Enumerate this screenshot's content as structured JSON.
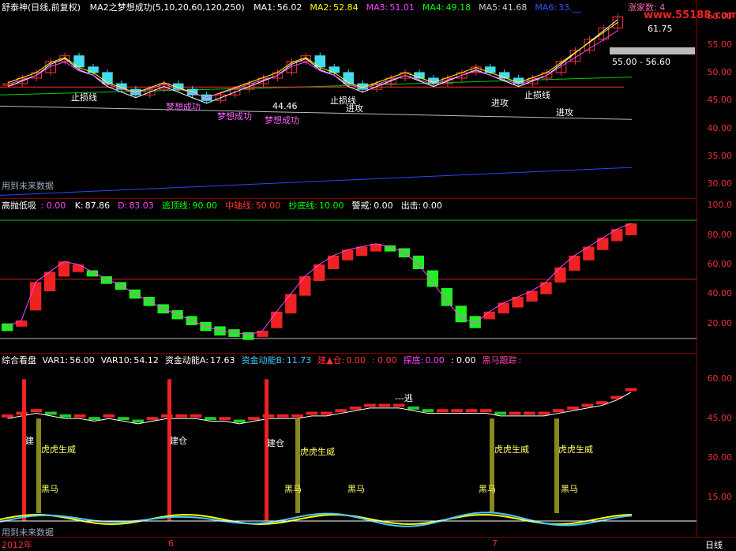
{
  "main_pane": {
    "title": "舒泰神(日线,前复权)",
    "indicator": "MA2之梦想成功(5,10,20,60,120,250)",
    "ma": [
      {
        "label": "MA1:",
        "value": "56.02",
        "color": "#ffffff"
      },
      {
        "label": "MA2:",
        "value": "52.84",
        "color": "#ffff00"
      },
      {
        "label": "MA3:",
        "value": "51.01",
        "color": "#ff44ff"
      },
      {
        "label": "MA4:",
        "value": "49.18",
        "color": "#00ff00"
      },
      {
        "label": "MA5:",
        "value": "41.68",
        "color": "#cccccc"
      },
      {
        "label": "MA6:",
        "value": "33.__",
        "color": "#3355ff"
      }
    ],
    "up_count": "涨家数: 4",
    "watermark": "www.55188.com",
    "y_ticks": [
      "60.00",
      "55.00",
      "50.00",
      "45.00",
      "40.00",
      "35.00",
      "30.00"
    ],
    "y_range": [
      27.5,
      63
    ],
    "high_label": "61.75",
    "price_box": "55.00 - 56.60",
    "low_label": "44.46",
    "future_note": "用到未来数据",
    "annotations": [
      {
        "text": "止损线",
        "color": "#ffffff"
      },
      {
        "text": "梦想成功",
        "color": "#ff66ff"
      },
      {
        "text": "梦想成功",
        "color": "#ff66ff"
      },
      {
        "text": "梦想成功",
        "color": "#ff66ff"
      },
      {
        "text": "止损线",
        "color": "#ffffff"
      },
      {
        "text": "进攻",
        "color": "#ffffff"
      },
      {
        "text": "进攻",
        "color": "#ffffff"
      },
      {
        "text": "止损线",
        "color": "#ffffff"
      },
      {
        "text": "进攻",
        "color": "#ffffff"
      }
    ]
  },
  "mid_pane": {
    "title": "高抛低吸",
    "title_value": ": 0.00",
    "items": [
      {
        "label": "K:",
        "value": "87.86",
        "color": "#ffffff"
      },
      {
        "label": "D:",
        "value": "83.03",
        "color": "#ff44ff"
      },
      {
        "label": "逃顶线:",
        "value": "90.00",
        "color": "#00ff00"
      },
      {
        "label": "中轴线:",
        "value": "50.00",
        "color": "#ff3333"
      },
      {
        "label": "抄底线:",
        "value": "10.00",
        "color": "#00ff00"
      },
      {
        "label": "警戒:",
        "value": "0.00",
        "color": "#ffffff"
      },
      {
        "label": "出击:",
        "value": "0.00",
        "color": "#ffffff"
      }
    ],
    "y_ticks": [
      "100.0",
      "80.00",
      "60.00",
      "40.00",
      "20.00"
    ],
    "y_range": [
      0,
      105
    ]
  },
  "low_pane": {
    "title": "综合看盘",
    "items": [
      {
        "label": "VAR1:",
        "value": "56.00",
        "color": "#ffffff"
      },
      {
        "label": "VAR10:",
        "value": "54.12",
        "color": "#ffffff"
      },
      {
        "label": "资金动能A:",
        "value": "17.63",
        "color": "#ffffff"
      },
      {
        "label": "资金动能B:",
        "value": "11.73",
        "color": "#44ccff"
      },
      {
        "label": "建▲仓:",
        "value": "0.00",
        "color": "#ff3333"
      },
      {
        "label": "",
        "value": ": 0.00",
        "color": "#ff3333"
      },
      {
        "label": "探底:",
        "value": "0.00",
        "color": "#ff44ff"
      },
      {
        "label": "",
        "value": ": 0.00",
        "color": "#ffffff"
      },
      {
        "label": "黑马跟踪",
        "value": ":",
        "color": "#ff44aa"
      }
    ],
    "y_ticks": [
      "60.00",
      "45.00",
      "30.00",
      "15.00"
    ],
    "y_range": [
      0,
      70
    ],
    "escape_label": "---逃",
    "future_note": "用到未来数据",
    "labels": {
      "build": "建仓",
      "build_partial": "建",
      "tiger": "虎虎生威",
      "horse": "黑马"
    }
  },
  "kd": {
    "k": [
      18,
      22,
      48,
      55,
      62,
      60,
      55,
      50,
      46,
      40,
      35,
      30,
      26,
      22,
      18,
      15,
      14,
      12,
      15,
      28,
      40,
      52,
      60,
      66,
      70,
      72,
      74,
      72,
      68,
      60,
      48,
      35,
      24,
      20,
      28,
      34,
      38,
      42,
      48,
      58,
      66,
      72,
      78,
      84,
      87.86
    ],
    "d": [
      20,
      21,
      32,
      45,
      55,
      58,
      56,
      52,
      48,
      43,
      38,
      33,
      29,
      25,
      21,
      18,
      16,
      14,
      14,
      20,
      30,
      42,
      52,
      60,
      66,
      69,
      72,
      73,
      71,
      66,
      56,
      44,
      32,
      25,
      26,
      30,
      34,
      38,
      43,
      51,
      59,
      66,
      73,
      79,
      83.03
    ]
  },
  "bottom_bar": {
    "year": "2012年",
    "months": [
      "6",
      "7"
    ],
    "period": "日线"
  }
}
